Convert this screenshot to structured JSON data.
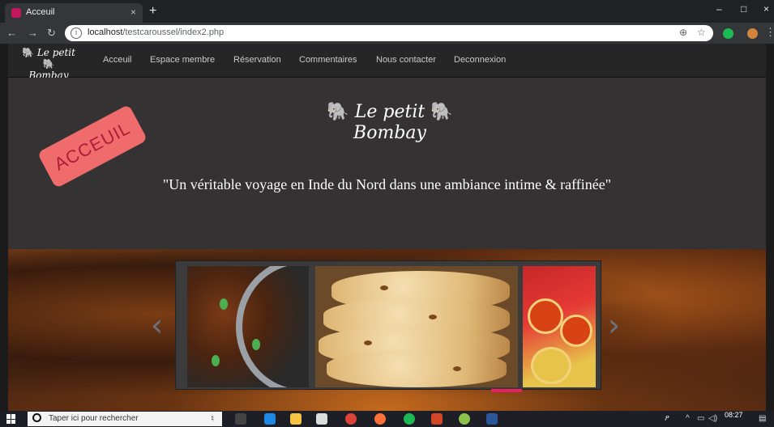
{
  "browser": {
    "tab_title": "Acceuil",
    "tab_close": "×",
    "new_tab": "+",
    "url_host": "localhost",
    "url_path": "/testcaroussel/index2.php",
    "window_minimize": "–",
    "window_maximize": "□",
    "window_close": "×"
  },
  "site": {
    "logo_line1": "Le petit",
    "logo_line2": "Bombay",
    "nav": [
      {
        "label": "Acceuil"
      },
      {
        "label": "Espace membre"
      },
      {
        "label": "Réservation"
      },
      {
        "label": "Commentaires"
      },
      {
        "label": "Nous contacter"
      },
      {
        "label": "Deconnexion"
      }
    ],
    "hero_logo_line1": "Le petit",
    "hero_logo_line2": "Bombay",
    "stamp_text": "ACCEUIL",
    "tagline": "\"Un véritable voyage en Inde du Nord dans une ambiance intime & raffinée\""
  },
  "carousel": {
    "prev_arrow": "‹",
    "next_arrow": "›"
  },
  "taskbar": {
    "search_placeholder": "Taper ici pour rechercher",
    "time": "08:27"
  },
  "colors": {
    "accent_pink": "#e91e63",
    "stamp": "#f06b6b",
    "elephant": "#e4573d"
  }
}
